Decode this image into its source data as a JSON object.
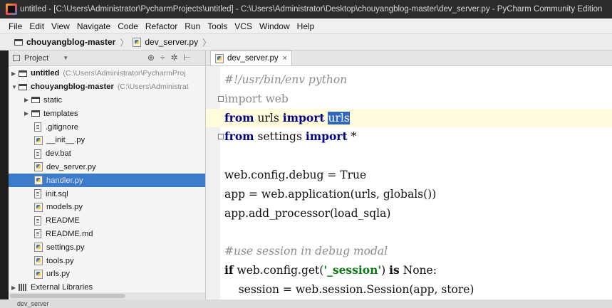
{
  "window": {
    "title": "untitled - [C:\\Users\\Administrator\\PycharmProjects\\untitled] - C:\\Users\\Administrator\\Desktop\\chouyangblog-master\\dev_server.py - PyCharm Community Edition"
  },
  "menu": [
    "File",
    "Edit",
    "View",
    "Navigate",
    "Code",
    "Refactor",
    "Run",
    "Tools",
    "VCS",
    "Window",
    "Help"
  ],
  "breadcrumb": {
    "folder": "chouyangblog-master",
    "file": "dev_server.py"
  },
  "project_panel": {
    "title": "Project",
    "tree": [
      {
        "label": "untitled",
        "path": "(C:\\Users\\Administrator\\PycharmProj",
        "type": "folder",
        "level": 0,
        "arrow": "▶",
        "bold": true
      },
      {
        "label": "chouyangblog-master",
        "path": "(C:\\Users\\Administrat",
        "type": "folder",
        "level": 0,
        "arrow": "▼",
        "bold": true
      },
      {
        "label": "static",
        "type": "folder",
        "level": 1,
        "arrow": "▶"
      },
      {
        "label": "templates",
        "type": "folder",
        "level": 1,
        "arrow": "▶"
      },
      {
        "label": ".gitignore",
        "type": "file",
        "level": 1
      },
      {
        "label": "__init__.py",
        "type": "py",
        "level": 1
      },
      {
        "label": "dev.bat",
        "type": "file",
        "level": 1
      },
      {
        "label": "dev_server.py",
        "type": "py",
        "level": 1
      },
      {
        "label": "handler.py",
        "type": "py",
        "level": 1,
        "selected": true
      },
      {
        "label": "init.sql",
        "type": "file",
        "level": 1
      },
      {
        "label": "models.py",
        "type": "py",
        "level": 1
      },
      {
        "label": "README",
        "type": "file",
        "level": 1
      },
      {
        "label": "README.md",
        "type": "file",
        "level": 1
      },
      {
        "label": "settings.py",
        "type": "py",
        "level": 1
      },
      {
        "label": "tools.py",
        "type": "py",
        "level": 1
      },
      {
        "label": "urls.py",
        "type": "py",
        "level": 1
      },
      {
        "label": "External Libraries",
        "type": "lib",
        "level": 0,
        "arrow": "▶"
      }
    ]
  },
  "editor": {
    "tab": "dev_server.py",
    "lines": [
      {
        "n": 0,
        "segs": [
          {
            "t": "#!/usr/bin/env python",
            "c": "cm"
          }
        ]
      },
      {
        "n": 1,
        "fold": true,
        "segs": [
          {
            "t": "import",
            "c": "kw-faded"
          },
          {
            "t": " web",
            "c": "kw-faded"
          }
        ]
      },
      {
        "n": 2,
        "hl": true,
        "segs": [
          {
            "t": "from",
            "c": "kw"
          },
          {
            "t": " urls "
          },
          {
            "t": "import",
            "c": "kw"
          },
          {
            "t": " "
          },
          {
            "t": "urls",
            "c": "sel"
          }
        ]
      },
      {
        "n": 3,
        "fold": true,
        "segs": [
          {
            "t": "from",
            "c": "kw"
          },
          {
            "t": " settings "
          },
          {
            "t": "import",
            "c": "kw"
          },
          {
            "t": " *"
          }
        ]
      },
      {
        "n": 4,
        "segs": []
      },
      {
        "n": 5,
        "segs": [
          {
            "t": "web.config.debug = True"
          }
        ]
      },
      {
        "n": 6,
        "segs": [
          {
            "t": "app = web.application(urls, globals())"
          }
        ]
      },
      {
        "n": 7,
        "segs": [
          {
            "t": "app.add_processor(load_sqla)"
          }
        ]
      },
      {
        "n": 8,
        "segs": []
      },
      {
        "n": 9,
        "segs": [
          {
            "t": "#use session in debug modal",
            "c": "cm"
          }
        ]
      },
      {
        "n": 10,
        "segs": [
          {
            "t": "if",
            "c": "kwd"
          },
          {
            "t": " web.config.get("
          },
          {
            "t": "'_session'",
            "c": "str"
          },
          {
            "t": ") "
          },
          {
            "t": "is",
            "c": "kwd"
          },
          {
            "t": " None:"
          }
        ]
      },
      {
        "n": 11,
        "segs": [
          {
            "t": "    session = web.session.Session(app, store)"
          }
        ]
      }
    ]
  },
  "status": {
    "text": "dev_server"
  }
}
